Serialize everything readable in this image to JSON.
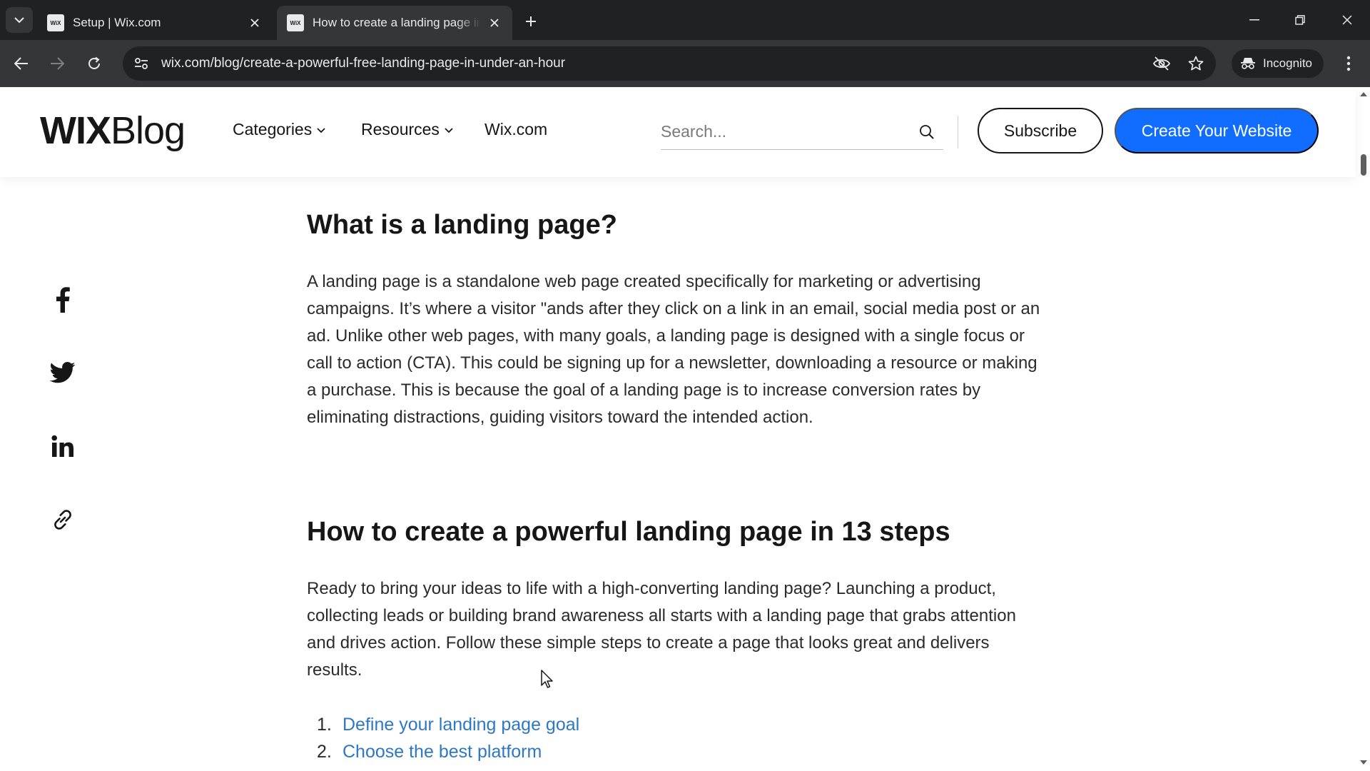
{
  "browser": {
    "tabs": [
      {
        "title": "Setup | Wix.com",
        "favicon": "WiX",
        "active": false
      },
      {
        "title": "How to create a landing page in",
        "favicon": "WiX",
        "active": true
      }
    ],
    "url": "wix.com/blog/create-a-powerful-free-landing-page-in-under-an-hour",
    "incognito_label": "Incognito"
  },
  "header": {
    "logo_wix": "WIX",
    "logo_blog": "Blog",
    "nav": [
      {
        "label": "Categories",
        "has_dropdown": true
      },
      {
        "label": "Resources",
        "has_dropdown": true
      },
      {
        "label": "Wix.com",
        "has_dropdown": false
      }
    ],
    "search_placeholder": "Search...",
    "subscribe_label": "Subscribe",
    "create_label": "Create Your Website",
    "accent_color": "#116dff"
  },
  "share": [
    "facebook-icon",
    "twitter-icon",
    "linkedin-icon",
    "copy-link-icon"
  ],
  "article": {
    "heading1": "What is a landing page?",
    "para1": "A landing page is a standalone web page created specifically for marketing or advertising campaigns. It’s where a visitor \"ands after they click on a link in an email, social media post or an ad. Unlike other web pages, with many goals, a landing page is designed with a single focus or call to action (CTA). This could be signing up for a newsletter, downloading a resource or making a purchase. This is because the goal of a landing page is to increase conversion rates by eliminating distractions, guiding visitors toward the intended action.",
    "heading2": "How to create a powerful landing page in 13 steps",
    "para2": "Ready to bring your ideas to life with a high-converting landing page? Launching a product, collecting leads or building brand awareness all starts with a landing page that grabs attention and drives action. Follow these simple steps to create a page that looks great and delivers results.",
    "steps": [
      {
        "num": "1.",
        "label": "Define your landing page goal"
      },
      {
        "num": "2.",
        "label": "Choose the best platform"
      }
    ],
    "link_color": "#2d77c7"
  }
}
